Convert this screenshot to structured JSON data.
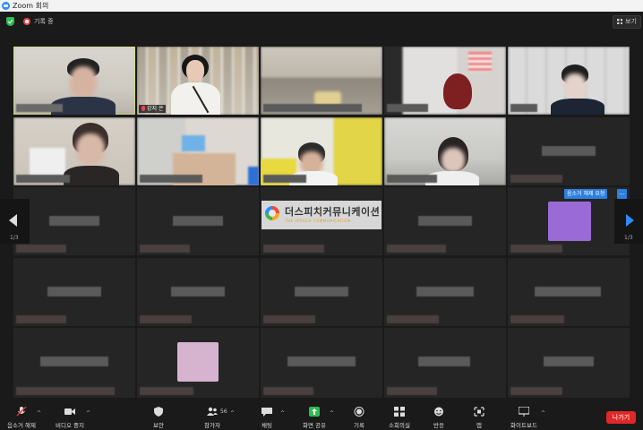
{
  "window": {
    "title": "Zoom 회의"
  },
  "topbar": {
    "recording_label": "기록 중",
    "view_label": "보기"
  },
  "grid": {
    "page_left": "1/3",
    "page_right": "1/3",
    "unmute_request": "음소거 해제 요청",
    "more": "...",
    "featured_name": "강지 은"
  },
  "watermark": {
    "text": "더스피치커뮤니케이션",
    "sub": "THE SPEECH COMMUNICATION"
  },
  "toolbar": {
    "mute": "음소거 해제",
    "video": "비디오 중지",
    "security": "보안",
    "participants": "참가자",
    "participants_count": "56",
    "chat": "채팅",
    "share": "화면 공유",
    "record": "기록",
    "breakout": "소회의실",
    "reactions": "반응",
    "apps": "앱",
    "whiteboard": "화이트보드",
    "leave": "나가기"
  },
  "colors": {
    "accent_blue": "#2d8cff",
    "active_speaker": "#c9dd3c",
    "leave_red": "#e02828",
    "share_green": "#2dbd52"
  }
}
